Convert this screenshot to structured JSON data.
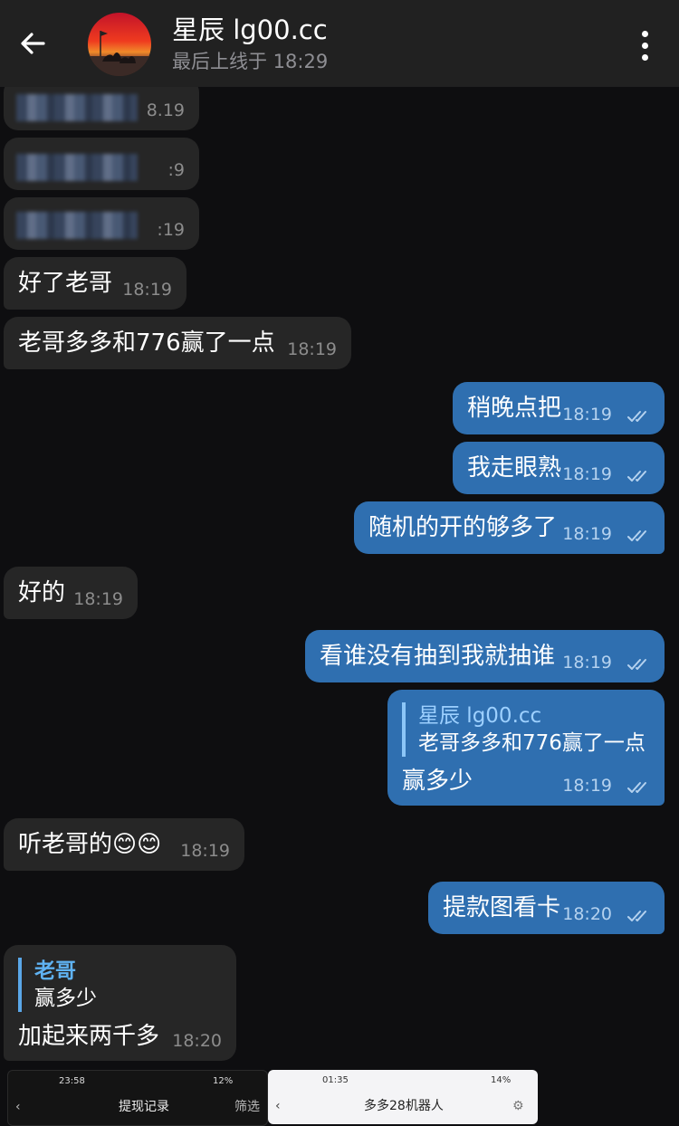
{
  "header": {
    "back_icon": "arrow-left-icon",
    "title": "星辰 lg00.cc",
    "status": "最后上线于 18:29",
    "menu_icon": "more-vertical-icon"
  },
  "messages": [
    {
      "dir": "in",
      "text": "",
      "time": "8.19",
      "blurred": true
    },
    {
      "dir": "in",
      "text": "",
      "time": ":9",
      "blurred": true
    },
    {
      "dir": "in",
      "text": "",
      "time": ":19",
      "blurred": true
    },
    {
      "dir": "in",
      "text": "好了老哥",
      "time": "18:19"
    },
    {
      "dir": "in",
      "text": "老哥多多和776赢了一点",
      "time": "18:19"
    },
    {
      "dir": "out",
      "text": "稍晚点把",
      "time": "18:19"
    },
    {
      "dir": "out",
      "text": "我走眼熟",
      "time": "18:19"
    },
    {
      "dir": "out",
      "text": "随机的开的够多了",
      "time": "18:19"
    },
    {
      "dir": "in",
      "text": "好的",
      "time": "18:19"
    },
    {
      "dir": "out",
      "text": "看谁没有抽到我就抽谁",
      "time": "18:19"
    },
    {
      "dir": "out",
      "text": "赢多少",
      "time": "18:19",
      "reply_name": "星辰 lg00.cc",
      "reply_text": "老哥多多和776赢了一点"
    },
    {
      "dir": "in",
      "text": "听老哥的😊😊",
      "time": "18:19"
    },
    {
      "dir": "out",
      "text": "提款图看卡",
      "time": "18:20"
    },
    {
      "dir": "in",
      "text": "加起来两千多",
      "time": "18:20",
      "reply_name": "老哥",
      "reply_text": "赢多少"
    }
  ],
  "attachment": {
    "left": {
      "clock": "23:58",
      "battery": "12%",
      "title": "提现记录",
      "action": "筛选"
    },
    "right": {
      "clock": "01:35",
      "battery": "14%",
      "title": "多多28机器人"
    }
  },
  "colors": {
    "background": "#0e0e10",
    "header": "#212121",
    "incoming": "#262626",
    "outgoing": "#2f6fb0",
    "accent": "#5fb2f2"
  }
}
